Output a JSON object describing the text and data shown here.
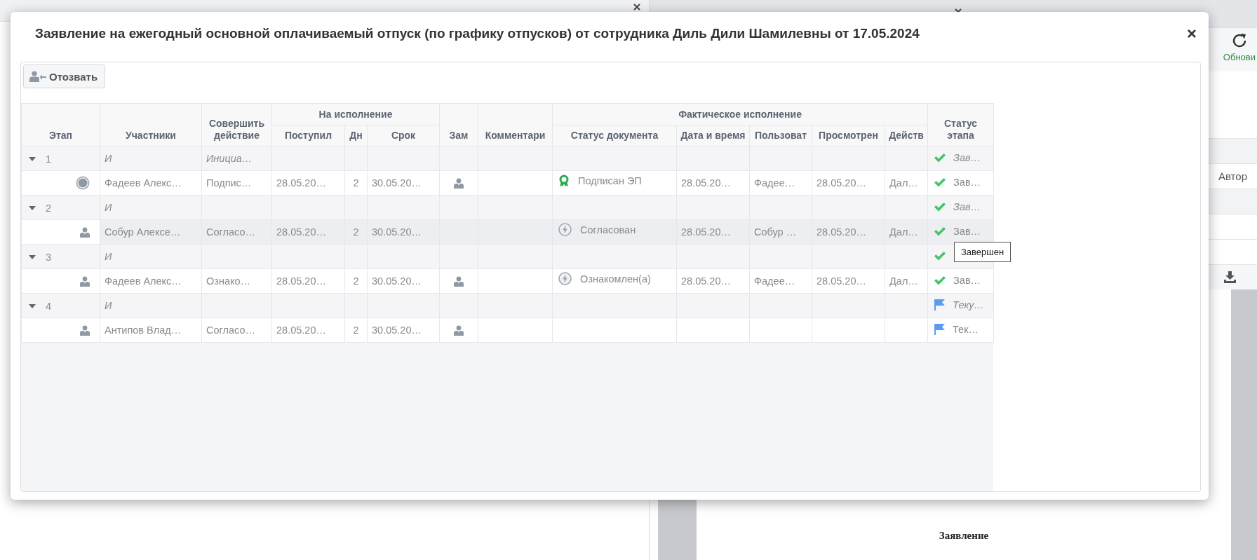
{
  "background": {
    "refresh_label": "Обнови",
    "column_header": "Автор",
    "document_title": "Заявление"
  },
  "dialog": {
    "title": "Заявление на ежегодный основной оплачиваемый отпуск (по графику отпусков) от сотрудника Диль Дили Шамилевны от 17.05.2024",
    "recall_button": "Отозвать",
    "table": {
      "header": [
        {
          "label": "Этап"
        },
        {
          "label": "Участники"
        },
        {
          "label": "Совершить действие"
        },
        {
          "group": "На исполнение",
          "columns": [
            "Поступил",
            "Дн",
            "Срок"
          ]
        },
        {
          "label": "Зам"
        },
        {
          "label": "Комментари"
        },
        {
          "group": "Фактическое исполнение",
          "columns": [
            "Статус документа",
            "Дата и время",
            "Пользоват",
            "Просмотрен",
            "Действ"
          ]
        },
        {
          "label": "Статус этапа"
        }
      ],
      "stages": [
        {
          "number": "1",
          "expanded": true,
          "participant": "И",
          "action": "Инициа…",
          "status": {
            "kind": "done",
            "text": "Зав…"
          },
          "children": [
            {
              "selected": false,
              "kind": "initiator",
              "name": "Фадеев Алекс…",
              "action": "Подпис…",
              "received": "28.05.20…",
              "days": "2",
              "due": "30.05.20…",
              "substitute": true,
              "doc_status": {
                "kind": "signed",
                "text": "Подписан ЭП"
              },
              "date": "28.05.20…",
              "user": "Фадее…",
              "viewed": "28.05.20…",
              "performed": "Дал…",
              "status": {
                "kind": "done",
                "text": "Зав…"
              }
            }
          ]
        },
        {
          "number": "2",
          "expanded": true,
          "participant": "И",
          "status": {
            "kind": "done",
            "text": "Зав…"
          },
          "children": [
            {
              "selected": true,
              "kind": "participant",
              "name": "Собур Алексе…",
              "action": "Согласо…",
              "received": "28.05.20…",
              "days": "2",
              "due": "30.05.20…",
              "substitute": false,
              "doc_status": {
                "kind": "processed",
                "text": "Согласован"
              },
              "date": "28.05.20…",
              "user": "Собур …",
              "viewed": "28.05.20…",
              "performed": "Дал…",
              "status": {
                "kind": "done",
                "text": "Зав…"
              }
            }
          ]
        },
        {
          "number": "3",
          "expanded": true,
          "participant": "И",
          "status": {
            "kind": "done"
          },
          "children": [
            {
              "selected": false,
              "kind": "participant",
              "name": "Фадеев Алекс…",
              "action": "Ознако…",
              "received": "28.05.20…",
              "days": "2",
              "due": "30.05.20…",
              "substitute": true,
              "doc_status": {
                "kind": "processed",
                "text": "Ознакомлен(а)"
              },
              "date": "28.05.20…",
              "user": "Фадее…",
              "viewed": "28.05.20…",
              "performed": "Дал…",
              "status": {
                "kind": "done",
                "text": "Зав…"
              }
            }
          ]
        },
        {
          "number": "4",
          "expanded": true,
          "participant": "И",
          "status": {
            "kind": "current",
            "text": "Теку…"
          },
          "children": [
            {
              "selected": false,
              "kind": "participant",
              "name": "Антипов Влад…",
              "action": "Согласо…",
              "received": "28.05.20…",
              "days": "2",
              "due": "30.05.20…",
              "substitute": true,
              "status": {
                "kind": "current",
                "text": "Тек…"
              }
            }
          ]
        }
      ]
    },
    "tooltip": "Завершен"
  }
}
